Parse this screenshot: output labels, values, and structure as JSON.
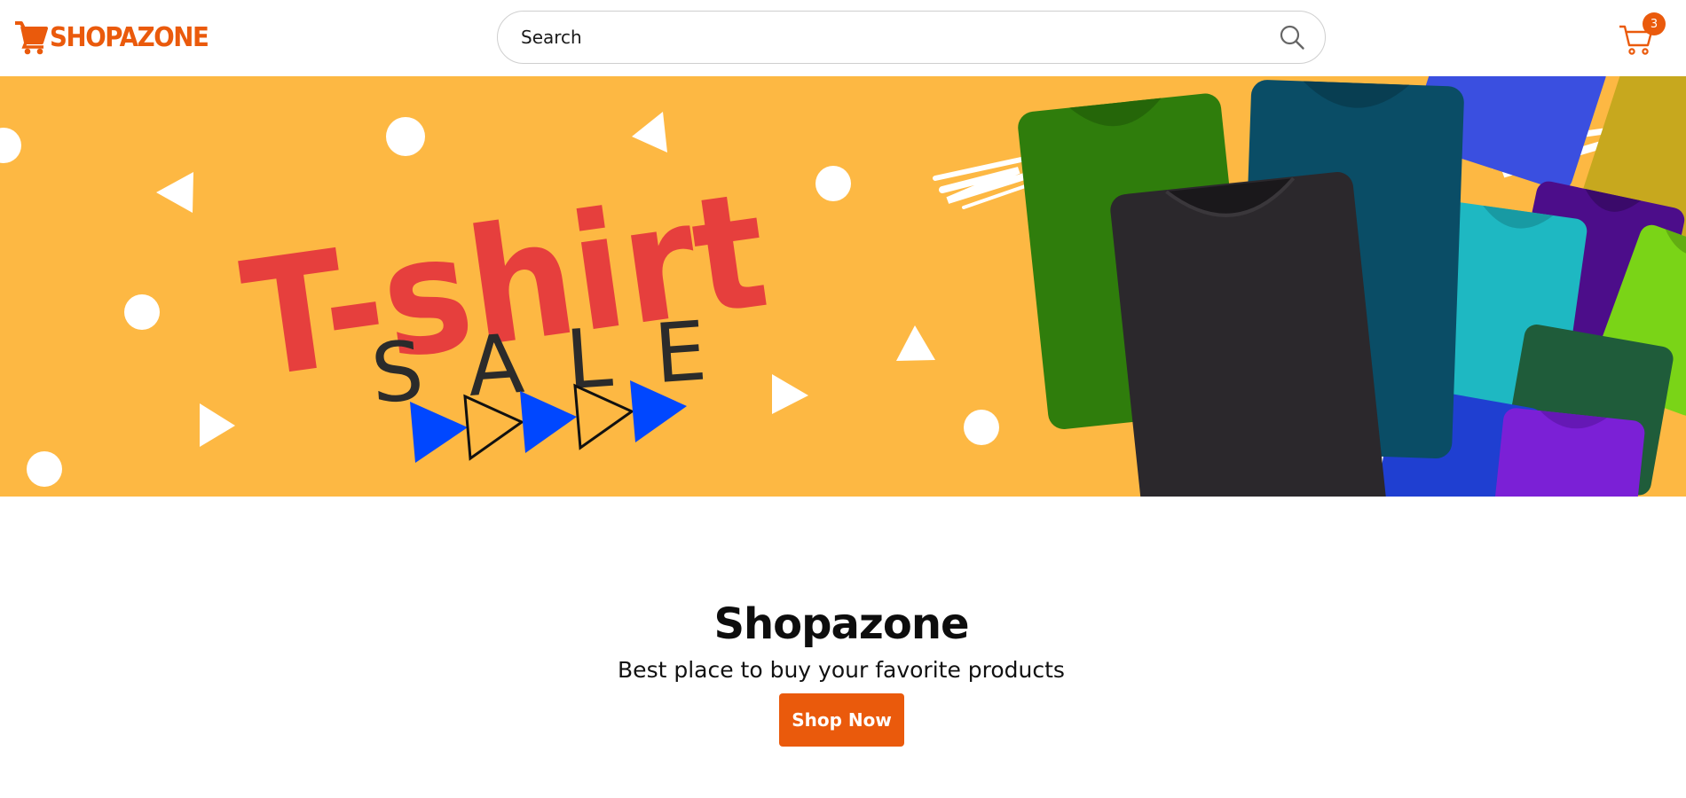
{
  "header": {
    "logo_text": "SHOPAZONE",
    "logo_icon": "shopping-cart-icon",
    "search": {
      "placeholder": "Search",
      "icon": "search-icon"
    },
    "cart": {
      "icon": "cart-icon",
      "count": "3"
    }
  },
  "banner": {
    "headline": "T-shirt",
    "subline": "SALE",
    "colors": {
      "background": "#fdb843",
      "headline": "#e63f3d",
      "subline": "#2b2b2b",
      "arrows": "#0047ff"
    },
    "tshirt_colors": [
      "#2f7d0c",
      "#0a4d66",
      "#2b282c",
      "#1f3fd1",
      "#1eb8c2",
      "#4c0d8a",
      "#7ad417",
      "#1f5c3a",
      "#7b20d6",
      "#c7a81e",
      "#3a4fe0"
    ]
  },
  "hero": {
    "title": "Shopazone",
    "subtitle": "Best place to buy your favorite products",
    "button_label": "Shop Now"
  },
  "theme": {
    "accent": "#ea5a0c"
  }
}
